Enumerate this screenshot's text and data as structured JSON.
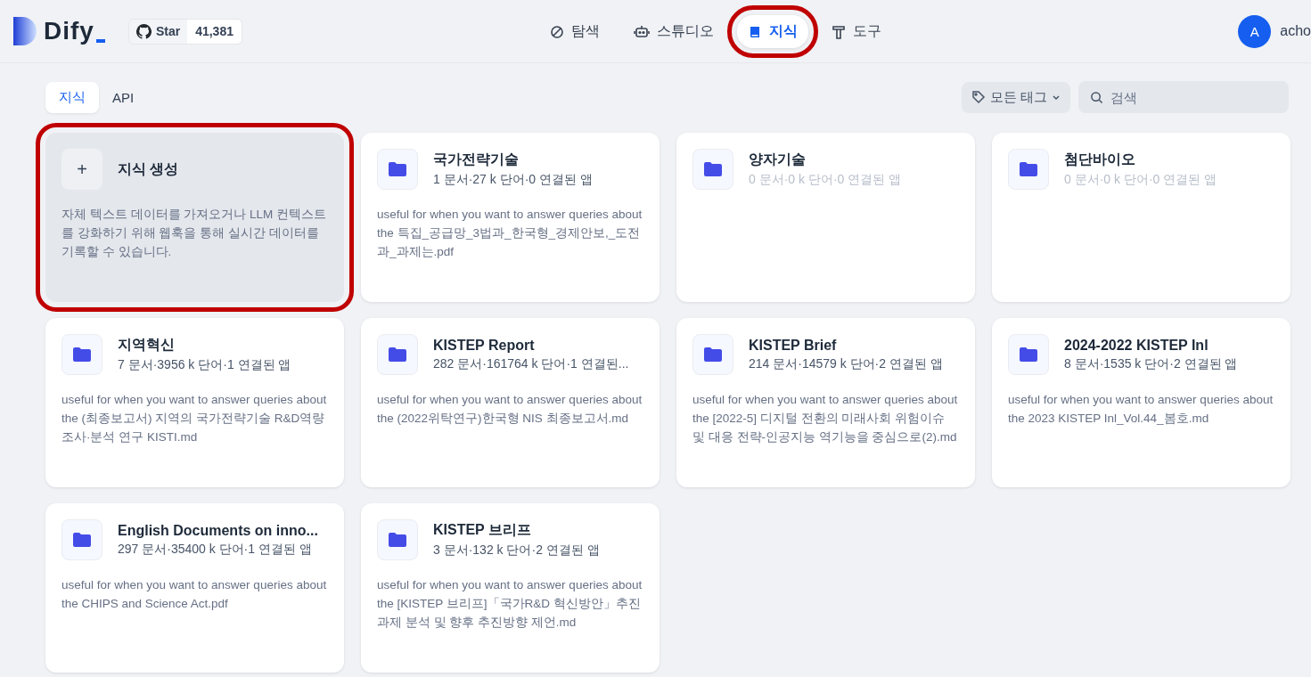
{
  "header": {
    "logo": "Dify",
    "github": {
      "label": "Star",
      "count": "41,381"
    },
    "nav": [
      {
        "label": "탐색",
        "selected": false,
        "highlighted": false
      },
      {
        "label": "스튜디오",
        "selected": false,
        "highlighted": false
      },
      {
        "label": "지식",
        "selected": true,
        "highlighted": true
      },
      {
        "label": "도구",
        "selected": false,
        "highlighted": false
      }
    ],
    "user": {
      "initial": "A",
      "name": "acho"
    }
  },
  "tabs": [
    {
      "label": "지식",
      "selected": true
    },
    {
      "label": "API",
      "selected": false
    }
  ],
  "tag_filter": {
    "label": "모든 태그"
  },
  "search": {
    "placeholder": "검색"
  },
  "create_card": {
    "title": "지식 생성",
    "icon": "+",
    "description": "자체 텍스트 데이터를 가져오거나 LLM 컨텍스트를 강화하기 위해 웹훅을 통해 실시간 데이터를 기록할 수 있습니다.",
    "highlighted": true
  },
  "datasets": [
    {
      "name": "국가전략기술",
      "meta": "1 문서·27 k 단어·0 연결된 앱",
      "empty": false,
      "description": "useful for when you want to answer queries about the 특집_공급망_3법과_한국형_경제안보,_도전과_과제는.pdf"
    },
    {
      "name": "양자기술",
      "meta": "0 문서·0 k 단어·0 연결된 앱",
      "empty": true
    },
    {
      "name": "첨단바이오",
      "meta": "0 문서·0 k 단어·0 연결된 앱",
      "empty": true
    },
    {
      "name": "지역혁신",
      "meta": "7 문서·3956 k 단어·1 연결된 앱",
      "empty": false,
      "description": "useful for when you want to answer queries about the (최종보고서) 지역의 국가전략기술 R&D역량 조사·분석 연구 KISTI.md"
    },
    {
      "name": "KISTEP Report",
      "meta": "282 문서·161764 k 단어·1 연결된...",
      "empty": false,
      "description": "useful for when you want to answer queries about the (2022위탁연구)한국형 NIS 최종보고서.md"
    },
    {
      "name": "KISTEP Brief",
      "meta": "214 문서·14579 k 단어·2 연결된 앱",
      "empty": false,
      "description": "useful for when you want to answer queries about the [2022-5] 디지털 전환의 미래사회 위험이슈 및 대응 전략-인공지능 역기능을 중심으로(2).md"
    },
    {
      "name": "2024-2022 KISTEP Inl",
      "meta": "8 문서·1535 k 단어·2 연결된 앱",
      "empty": false,
      "description": "useful for when you want to answer queries about the 2023 KISTEP Inl_Vol.44_봄호.md"
    },
    {
      "name": "English Documents on inno...",
      "meta": "297 문서·35400 k 단어·1 연결된 앱",
      "empty": false,
      "description": "useful for when you want to answer queries about the CHIPS and Science Act.pdf"
    },
    {
      "name": "KISTEP 브리프",
      "meta": "3 문서·132 k 단어·2 연결된 앱",
      "empty": false,
      "description": "useful for when you want to answer queries about the [KISTEP 브리프]「국가R&D 혁신방안」추진과제 분석 및 향후 추진방향 제언.md"
    }
  ]
}
